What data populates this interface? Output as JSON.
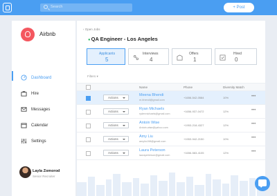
{
  "topbar": {
    "search_placeholder": "Search",
    "post_label": "+ Post"
  },
  "sidebar": {
    "brand": "Airbnb",
    "items": [
      {
        "label": "Dashboard",
        "icon": "dashboard-icon",
        "active": true
      },
      {
        "label": "Hire",
        "icon": "briefcase-icon",
        "active": false
      },
      {
        "label": "Messages",
        "icon": "envelope-icon",
        "active": false
      },
      {
        "label": "Calendar",
        "icon": "calendar-icon",
        "active": false
      },
      {
        "label": "Settings",
        "icon": "sliders-icon",
        "active": false
      }
    ],
    "user": {
      "name": "Layla Zomorod",
      "role": "Senior Recruiter"
    }
  },
  "main": {
    "back_label": "Open Jobs",
    "job_title": "QA Engineer - Los Angeles",
    "stages": [
      {
        "label": "Applicants",
        "count": "5",
        "icon": "",
        "active": true
      },
      {
        "label": "Interviews",
        "count": "4",
        "icon": "interviews-icon",
        "active": false
      },
      {
        "label": "Offers",
        "count": "1",
        "icon": "offers-icon",
        "active": false
      },
      {
        "label": "Hired",
        "count": "0",
        "icon": "hired-icon",
        "active": false
      }
    ],
    "filters_label": "Filters",
    "table": {
      "headers": {
        "name": "Name",
        "phone": "Phone",
        "match": "Diversity Match"
      },
      "action_label": "Actions",
      "rows": [
        {
          "name": "Meena Bhendi",
          "email": "m.bhendi@gmail.com",
          "phone": "+1656-542-0584",
          "match": "10%",
          "selected": true
        },
        {
          "name": "Ryan Michaels",
          "email": "rydennichaels@gmail.com",
          "phone": "+1656-937-0472",
          "match": "12%",
          "selected": false
        },
        {
          "name": "Antoin Wise",
          "email": "Antoin.wise@yahoo.com",
          "phone": "+1953-218-4327",
          "match": "12%",
          "selected": false
        },
        {
          "name": "Amy Liu",
          "email": "amyliu198@gmail.com",
          "phone": "+1953-942-2150",
          "match": "10%",
          "selected": false
        },
        {
          "name": "Laura Peterson",
          "email": "laurapeterson@gmail.com",
          "phone": "+1656-583-4105",
          "match": "12%",
          "selected": false
        }
      ]
    }
  },
  "colors": {
    "accent": "#4a9ef2",
    "brand": "#f4575f",
    "active_stage_bg": "#e4f0fd"
  }
}
